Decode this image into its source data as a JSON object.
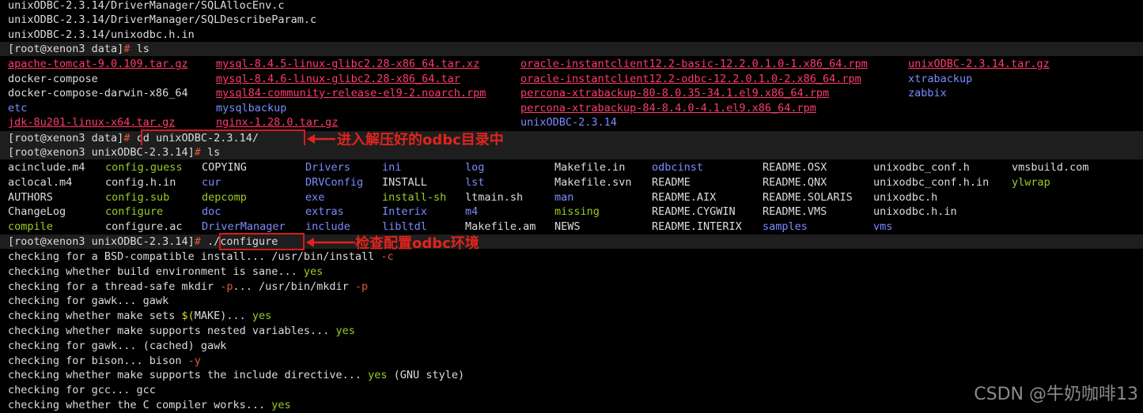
{
  "pre_lines": [
    "unixODBC-2.3.14/DriverManager/SQLAllocEnv.c",
    "unixODBC-2.3.14/DriverManager/SQLDescribeParam.c",
    "unixODBC-2.3.14/unixodbc.h.in"
  ],
  "prompt1": {
    "text": "[root@xenon3 data]",
    "hash": "#",
    "cmd": " ls"
  },
  "ls1_rows": [
    [
      "apache-tomcat-9.0.109.tar.gz",
      "mysql-8.4.5-linux-glibc2.28-x86_64.tar.xz",
      "oracle-instantclient12.2-basic-12.2.0.1.0-1.x86_64.rpm",
      "unixODBC-2.3.14.tar.gz"
    ],
    [
      "docker-compose",
      "mysql-8.4.6-linux-glibc2.28-x86_64.tar",
      "oracle-instantclient12.2-odbc-12.2.0.1.0-2.x86_64.rpm",
      "xtrabackup"
    ],
    [
      "docker-compose-darwin-x86_64",
      "mysql84-community-release-el9-2.noarch.rpm",
      "percona-xtrabackup-80-8.0.35-34.1.el9.x86_64.rpm",
      "zabbix"
    ],
    [
      "etc",
      "mysqlbackup",
      "percona-xtrabackup-84-8.4.0-4.1.el9.x86_64.rpm",
      ""
    ],
    [
      "jdk-8u201-linux-x64.tar.gz",
      "nginx-1.28.0.tar.gz",
      "unixODBC-2.3.14",
      ""
    ]
  ],
  "prompt2": {
    "text": "[root@xenon3 data]",
    "hash": "#",
    "cmd": " cd unixODBC-2.3.14/"
  },
  "prompt3": {
    "text": "[root@xenon3 unixODBC-2.3.14]",
    "hash": "#",
    "cmd": " ls"
  },
  "ls2_rows": [
    [
      "acinclude.m4",
      "config.guess",
      "COPYING",
      "Drivers",
      "ini",
      "log",
      "Makefile.in",
      "odbcinst",
      "README.OSX",
      "unixodbc_conf.h",
      "vmsbuild.com"
    ],
    [
      "aclocal.m4",
      "config.h.in",
      "cur",
      "DRVConfig",
      "INSTALL",
      "lst",
      "Makefile.svn",
      "README",
      "README.QNX",
      "unixodbc_conf.h.in",
      "ylwrap"
    ],
    [
      "AUTHORS",
      "config.sub",
      "depcomp",
      "exe",
      "install-sh",
      "ltmain.sh",
      "man",
      "README.AIX",
      "README.SOLARIS",
      "unixodbc.h",
      ""
    ],
    [
      "ChangeLog",
      "configure",
      "doc",
      "extras",
      "Interix",
      "m4",
      "missing",
      "README.CYGWIN",
      "README.VMS",
      "unixodbc.h.in",
      ""
    ],
    [
      "compile",
      "configure.ac",
      "DriverManager",
      "include",
      "libltdl",
      "Makefile.am",
      "NEWS",
      "README.INTERIX",
      "samples",
      "vms",
      ""
    ]
  ],
  "prompt4": {
    "text": "[root@xenon3 unixODBC-2.3.14]",
    "hash": "#",
    "cmd": " ./configure"
  },
  "configure_lines": [
    {
      "a": "checking for a BSD-compatible install... /usr/bin/install ",
      "b": "-c",
      "bc": "ora",
      "c": ""
    },
    {
      "a": "checking whether build environment is sane... ",
      "b": "yes",
      "bc": "grn",
      "c": ""
    },
    {
      "a": "checking for a thread-safe mkdir ",
      "b": "-p",
      "bc": "ora",
      "c": "... /usr/bin/mkdir ",
      "d": "-p",
      "dc": "ora"
    },
    {
      "a": "checking for gawk... gawk",
      "b": "",
      "bc": "",
      "c": ""
    },
    {
      "a": "checking whether make sets ",
      "b": "$(",
      "bc": "yel",
      "c": "MAKE)... ",
      "d": "yes",
      "dc": "grn"
    },
    {
      "a": "checking whether make supports nested variables... ",
      "b": "yes",
      "bc": "grn",
      "c": ""
    },
    {
      "a": "checking for gawk... ",
      "b": "(cached) gawk",
      "bc": "w",
      "c": ""
    },
    {
      "a": "checking for bison... bison ",
      "b": "-y",
      "bc": "ora",
      "c": ""
    },
    {
      "a": "checking whether make supports the include directive... ",
      "b": "yes",
      "bc": "grn",
      "c": " (GNU style)"
    },
    {
      "a": "checking for gcc... gcc",
      "b": "",
      "bc": "",
      "c": ""
    },
    {
      "a": "checking whether the C compiler works... ",
      "b": "yes",
      "bc": "grn",
      "c": ""
    }
  ],
  "annotations": {
    "cd_note": "进入解压好的odbc目录中",
    "configure_note": "检查配置odbc环境"
  },
  "watermark": "CSDN @牛奶咖啡13",
  "colors": {
    "archive": "#ff3b6b",
    "directory": "#7b8cff",
    "executable": "#9ccc22",
    "annotation": "#e0241b"
  }
}
